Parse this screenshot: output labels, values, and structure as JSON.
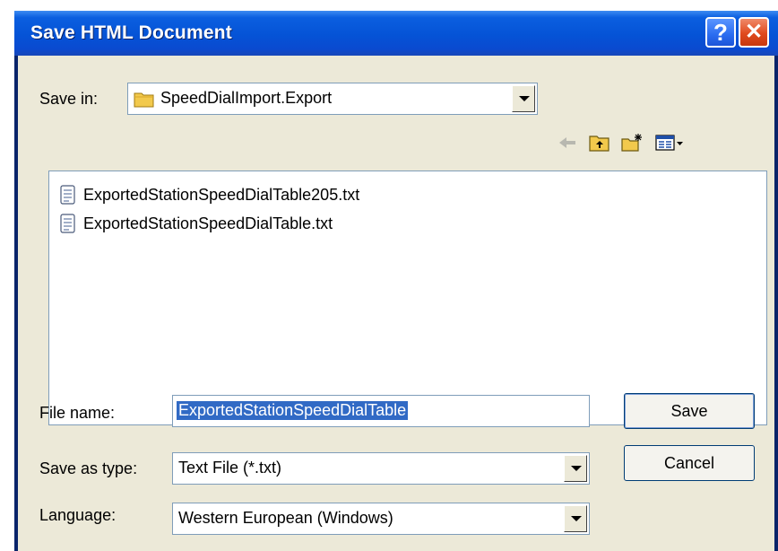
{
  "window": {
    "title": "Save HTML Document"
  },
  "title_buttons": {
    "help": "?",
    "close": "✕"
  },
  "toolbar": {
    "save_in_label": "Save in:",
    "folder": "SpeedDialImport.Export",
    "icons": [
      "folder-icon",
      "back-arrow-icon",
      "up-one-level-icon",
      "new-folder-icon",
      "view-menu-icon"
    ]
  },
  "files": [
    {
      "name": "ExportedStationSpeedDialTable205.txt",
      "icon": "text-file-icon"
    },
    {
      "name": "ExportedStationSpeedDialTable.txt",
      "icon": "text-file-icon"
    }
  ],
  "form": {
    "file_name_label": "File name:",
    "file_name_value": "ExportedStationSpeedDialTable",
    "save_as_type_label": "Save as type:",
    "save_as_type_value": "Text File (*.txt)",
    "language_label": "Language:",
    "language_value": "Western European (Windows)"
  },
  "buttons": {
    "save": "Save",
    "cancel": "Cancel"
  }
}
